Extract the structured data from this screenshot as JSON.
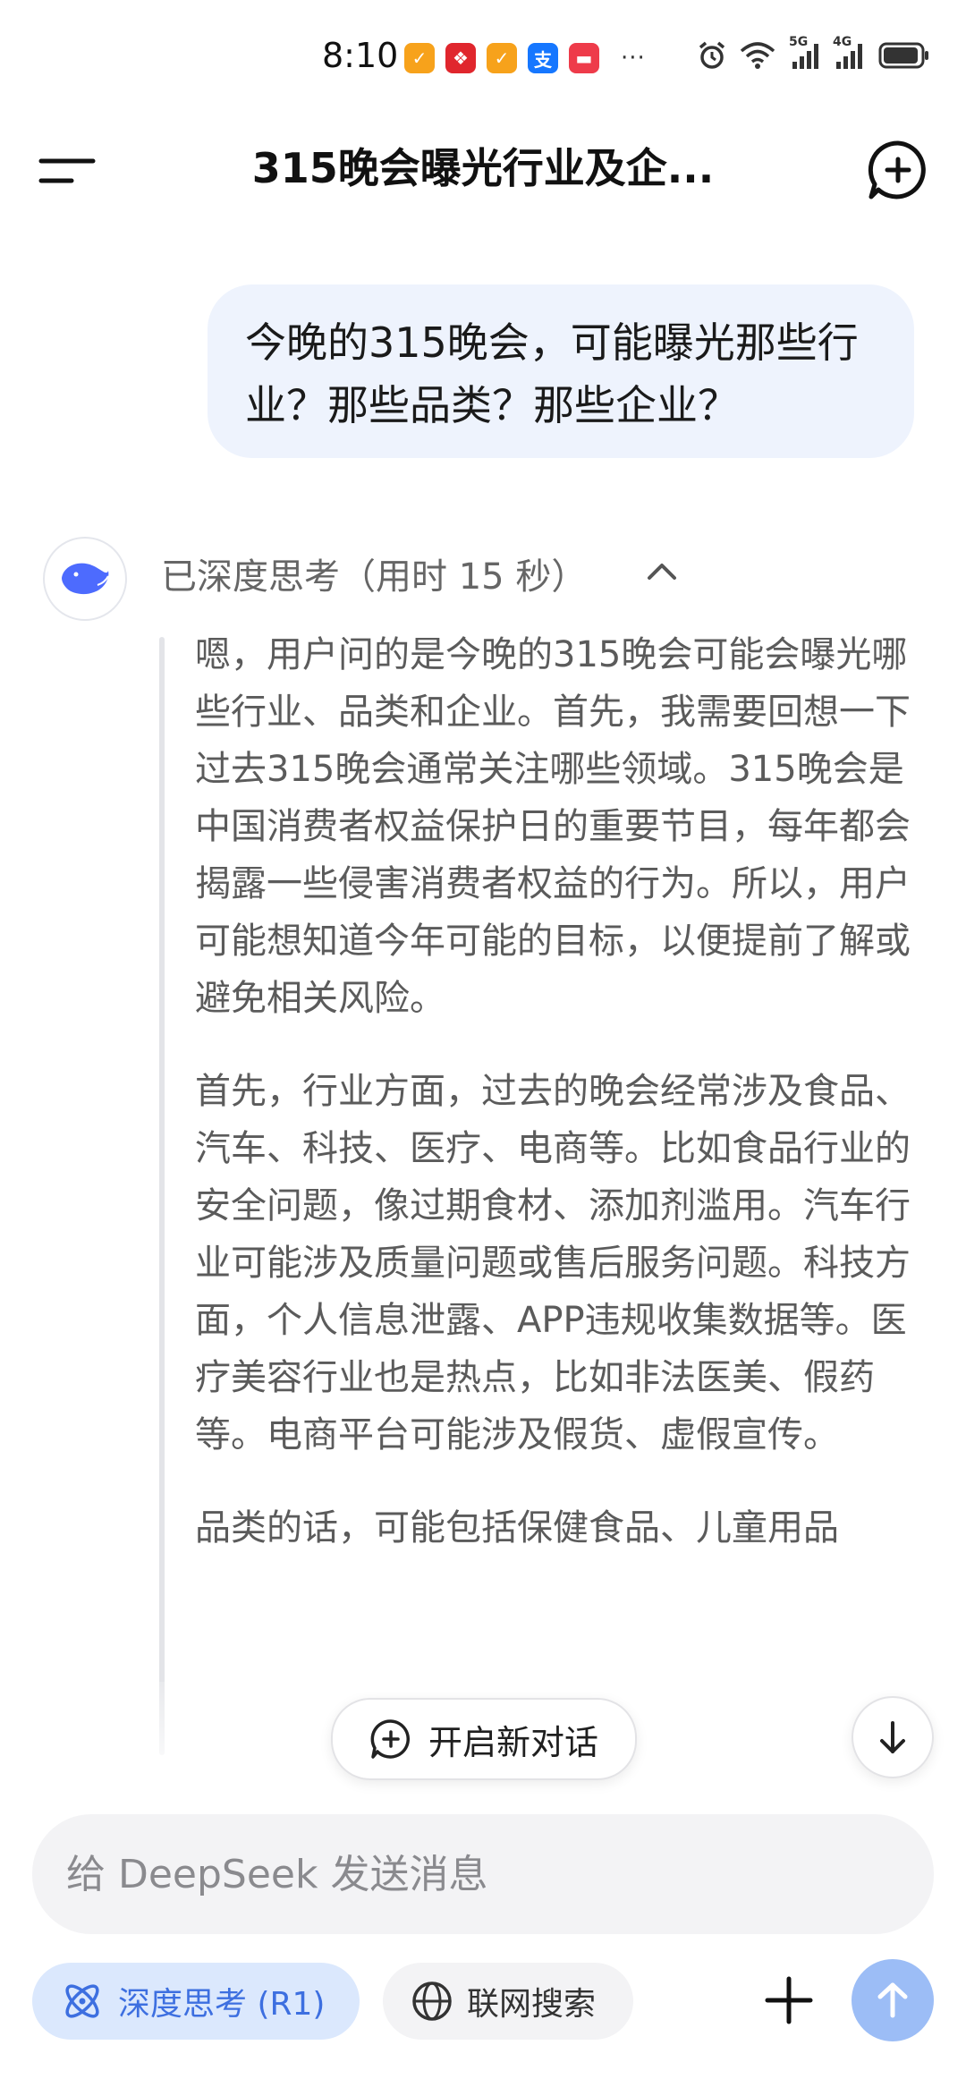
{
  "status_bar": {
    "time": "8:10",
    "app_icons": [
      {
        "name": "app-notification-icon-1",
        "color": "#f7a21b",
        "glyph": "✓"
      },
      {
        "name": "app-notification-icon-2",
        "color": "#e0262d",
        "glyph": "❖"
      },
      {
        "name": "app-notification-icon-3",
        "color": "#f7a21b",
        "glyph": "✓"
      },
      {
        "name": "alipay-icon",
        "color": "#1677ff",
        "glyph": "支"
      },
      {
        "name": "app-notification-icon-5",
        "color": "#ee3b4a",
        "glyph": "▬"
      }
    ],
    "more": "···",
    "network_labels": [
      "5G",
      "4G"
    ]
  },
  "header": {
    "title": "315晚会曝光行业及企..."
  },
  "conversation": {
    "user_message": "今晚的315晚会，可能曝光那些行业？那些品类？那些企业？",
    "thinking_label": "已深度思考（用时 15 秒）",
    "thinking_paragraphs": [
      "嗯，用户问的是今晚的315晚会可能会曝光哪些行业、品类和企业。首先，我需要回想一下过去315晚会通常关注哪些领域。315晚会是中国消费者权益保护日的重要节目，每年都会揭露一些侵害消费者权益的行为。所以，用户可能想知道今年可能的目标，以便提前了解或避免相关风险。",
      "首先，行业方面，过去的晚会经常涉及食品、汽车、科技、医疗、电商等。比如食品行业的安全问题，像过期食材、添加剂滥用。汽车行业可能涉及质量问题或售后服务问题。科技方面，个人信息泄露、APP违规收集数据等。医疗美容行业也是热点，比如非法医美、假药等。电商平台可能涉及假货、虚假宣传。",
      "品类的话，可能包括保健食品、儿童用品"
    ]
  },
  "floating": {
    "new_chat_label": "开启新对话"
  },
  "composer": {
    "placeholder": "给 DeepSeek 发送消息",
    "value": "",
    "deep_think_label": "深度思考 (R1)",
    "web_search_label": "联网搜索"
  },
  "colors": {
    "accent": "#4d6bfe",
    "user_bubble": "#eef3fd",
    "deep_think_bg": "#dbe8fd",
    "send_button": "#9cbdf6"
  }
}
